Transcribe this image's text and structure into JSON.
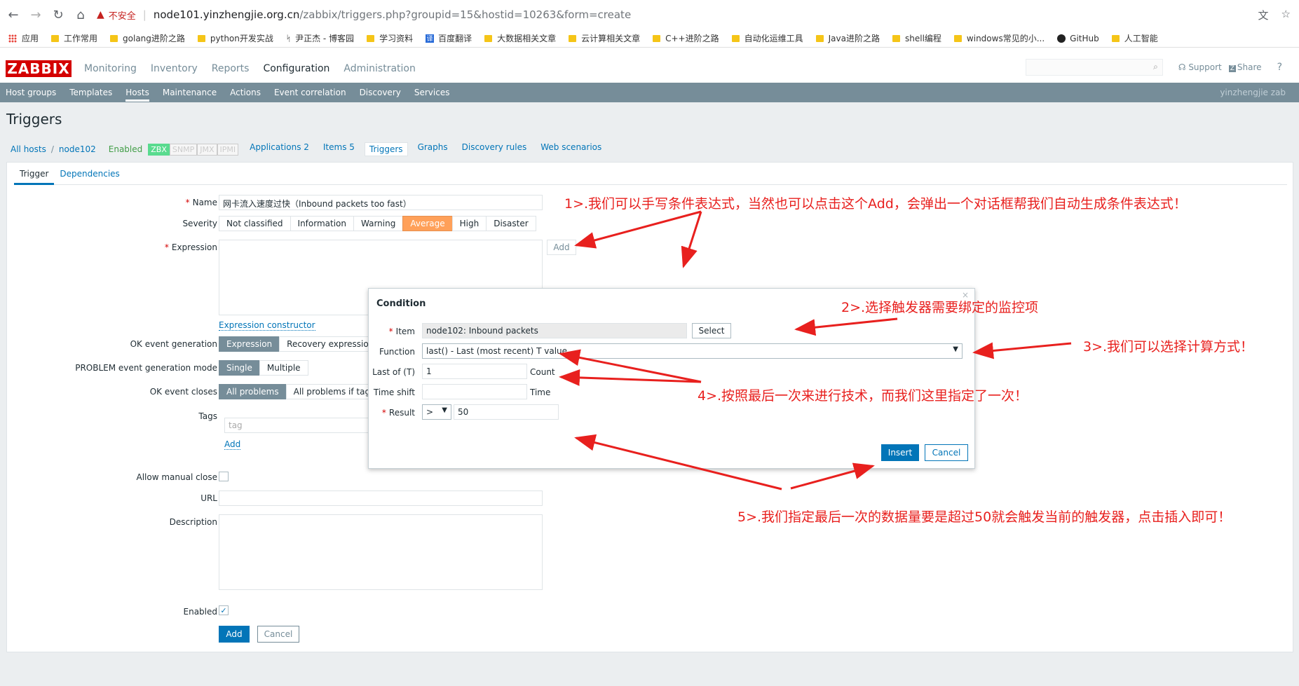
{
  "browser": {
    "insecure_label": "不安全",
    "url_host": "node101.yinzhengjie.org.cn",
    "url_path": "/zabbix/triggers.php?groupid=15&hostid=10263&form=create",
    "bookmarks": [
      "应用",
      "工作常用",
      "golang进阶之路",
      "python开发实战",
      "尹正杰 - 博客园",
      "学习资料",
      "百度翻译",
      "大数据相关文章",
      "云计算相关文章",
      "C++进阶之路",
      "自动化运维工具",
      "Java进阶之路",
      "shell编程",
      "windows常见的小...",
      "GitHub",
      "人工智能"
    ]
  },
  "header": {
    "logo": "ZABBIX",
    "menu": [
      "Monitoring",
      "Inventory",
      "Reports",
      "Configuration",
      "Administration"
    ],
    "support": "Support",
    "share": "Share",
    "help": "?"
  },
  "submenu": {
    "items": [
      "Host groups",
      "Templates",
      "Hosts",
      "Maintenance",
      "Actions",
      "Event correlation",
      "Discovery",
      "Services"
    ],
    "user": "yinzhengjie zab"
  },
  "page": {
    "title": "Triggers",
    "breadcrumbs": [
      "All hosts",
      "node102"
    ],
    "status": "Enabled",
    "badges": [
      "ZBX",
      "SNMP",
      "JMX",
      "IPMI"
    ],
    "tabs": [
      "Applications 2",
      "Items 5",
      "Triggers",
      "Graphs",
      "Discovery rules",
      "Web scenarios"
    ]
  },
  "form": {
    "tabs": [
      "Trigger",
      "Dependencies"
    ],
    "name_label": "Name",
    "name_value": "网卡流入速度过快（Inbound packets too fast）",
    "severity_label": "Severity",
    "severity_options": [
      "Not classified",
      "Information",
      "Warning",
      "Average",
      "High",
      "Disaster"
    ],
    "expression_label": "Expression",
    "add_label": "Add",
    "expression_constructor": "Expression constructor",
    "ok_event_gen_label": "OK event generation",
    "ok_event_gen_options": [
      "Expression",
      "Recovery expression"
    ],
    "problem_mode_label": "PROBLEM event generation mode",
    "problem_mode_options": [
      "Single",
      "Multiple"
    ],
    "ok_closes_label": "OK event closes",
    "ok_closes_options": [
      "All problems",
      "All problems if tag val"
    ],
    "tags_label": "Tags",
    "tag_placeholder": "tag",
    "tags_add": "Add",
    "manual_close_label": "Allow manual close",
    "url_label": "URL",
    "description_label": "Description",
    "enabled_label": "Enabled",
    "enabled_check": "✓",
    "submit": "Add",
    "cancel": "Cancel"
  },
  "dialog": {
    "title": "Condition",
    "close": "×",
    "item_label": "Item",
    "item_value": "node102: Inbound packets",
    "select_btn": "Select",
    "function_label": "Function",
    "function_value": "last() - Last (most recent) T value",
    "last_of_label": "Last of (T)",
    "last_of_value": "1",
    "count_label": "Count",
    "time_shift_label": "Time shift",
    "time_label": "Time",
    "result_label": "Result",
    "result_op": ">",
    "result_value": "50",
    "insert": "Insert",
    "cancel": "Cancel"
  },
  "annotations": [
    "1>.我们可以手写条件表达式，当然也可以点击这个Add，会弹出一个对话框帮我们自动生成条件表达式！",
    "2>.选择触发器需要绑定的监控项",
    "3>.我们可以选择计算方式！",
    "4>.按照最后一次来进行技术，而我们这里指定了一次！",
    "5>.我们指定最后一次的数据量要是超过50就会触发当前的触发器，点击插入即可！"
  ],
  "colors": {
    "zabbix_red": "#d40000",
    "submenu_bg": "#768d99",
    "link_blue": "#0275b8",
    "severity_average": "#ffa059",
    "annotation_red": "#e8201e"
  }
}
